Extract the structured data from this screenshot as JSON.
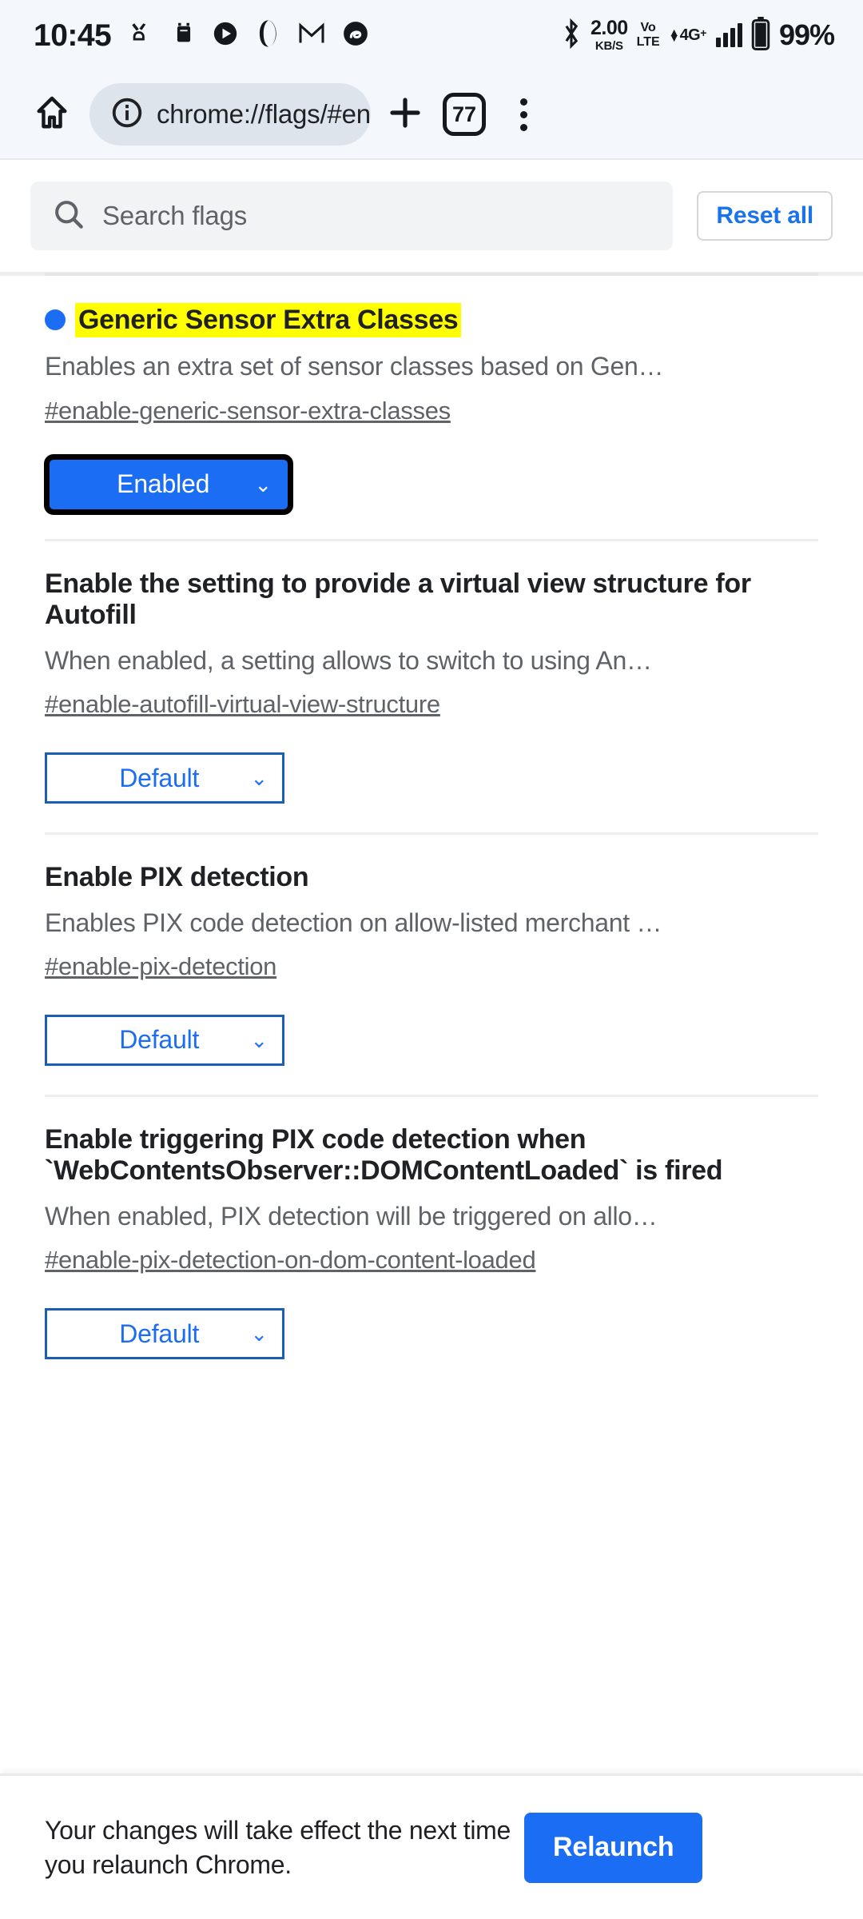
{
  "status_bar": {
    "time": "10:45",
    "left_icons": [
      "contacts-sync-icon",
      "alarm-icon",
      "play-circle-icon",
      "opera-icon",
      "gmail-icon",
      "threads-icon"
    ],
    "bluetooth": "bluetooth-icon",
    "net_speed_value": "2.00",
    "net_speed_unit": "KB/S",
    "volte_top": "Vo",
    "volte_bottom": "LTE",
    "network_type": "4G",
    "network_plus": "+",
    "battery_percent": "99%"
  },
  "toolbar": {
    "home_icon": "home-icon",
    "page_info_icon": "info-circle-icon",
    "url": "chrome://flags/#en",
    "new_tab_icon": "plus-icon",
    "tab_count": "77",
    "menu_icon": "more-vertical-icon"
  },
  "search": {
    "icon": "search-icon",
    "placeholder": "Search flags",
    "value": "",
    "reset_label": "Reset all"
  },
  "flags": [
    {
      "title": "Generic Sensor Extra Classes",
      "highlighted": true,
      "modified_dot": true,
      "description": "Enables an extra set of sensor classes based on Gen…",
      "id": "#enable-generic-sensor-extra-classes",
      "select_value": "Enabled",
      "select_state": "enabled"
    },
    {
      "title": "Enable the setting to provide a virtual view structure for Autofill",
      "highlighted": false,
      "modified_dot": false,
      "description": "When enabled, a setting allows to switch to using An…",
      "id": "#enable-autofill-virtual-view-structure",
      "select_value": "Default",
      "select_state": "default"
    },
    {
      "title": "Enable PIX detection",
      "highlighted": false,
      "modified_dot": false,
      "description": "Enables PIX code detection on allow-listed merchant …",
      "id": "#enable-pix-detection",
      "select_value": "Default",
      "select_state": "default"
    },
    {
      "title": "Enable triggering PIX code detection when `WebContentsObserver::DOMContentLoaded` is fired",
      "highlighted": false,
      "modified_dot": false,
      "description": "When enabled, PIX detection will be triggered on allo…",
      "id": "#enable-pix-detection-on-dom-content-loaded",
      "select_value": "Default",
      "select_state": "default"
    }
  ],
  "bottom_bar": {
    "message": "Your changes will take effect the next time you relaunch Chrome.",
    "relaunch_label": "Relaunch"
  },
  "colors": {
    "accent_blue": "#1b6ef3",
    "link_blue": "#1a73e8",
    "highlight_yellow": "#ffff00",
    "toolbar_bg": "#f4f7fc",
    "omnibox_bg": "#dde4ec",
    "muted_text": "#5f6368"
  }
}
